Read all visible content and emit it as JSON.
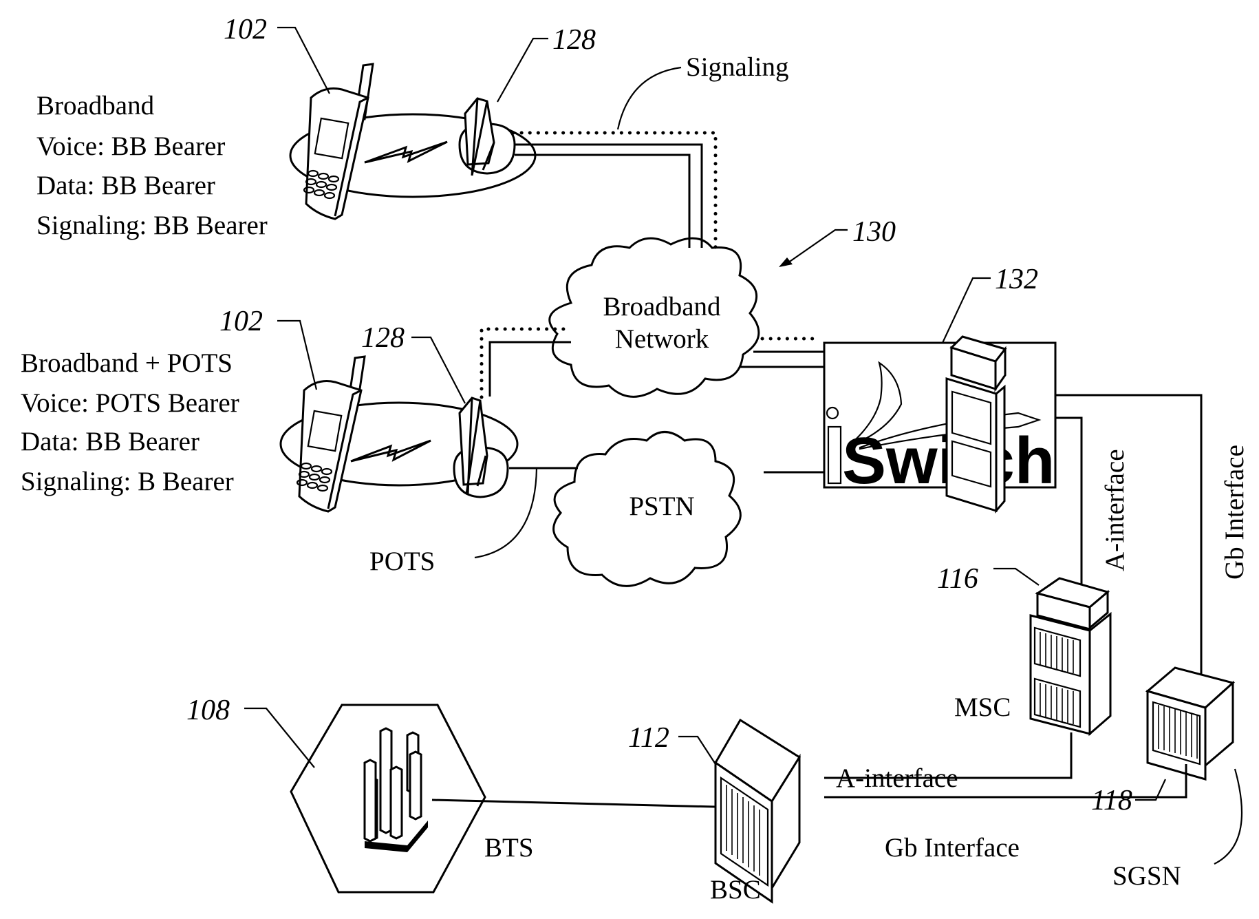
{
  "diagram": {
    "type": "network-architecture",
    "nodes": {
      "broadband_handset": {
        "ref": "102",
        "description_lines": [
          "Broadband",
          "Voice:  BB Bearer",
          "Data:   BB Bearer",
          "Signaling: BB Bearer"
        ],
        "icon": "mobile-phone-icon"
      },
      "broadband_base_station": {
        "ref": "128",
        "icon": "antenna-icon"
      },
      "pots_handset": {
        "ref": "102",
        "description_lines": [
          "Broadband + POTS",
          "Voice:  POTS Bearer",
          "Data:  BB Bearer",
          "Signaling: B Bearer"
        ],
        "icon": "mobile-phone-icon"
      },
      "pots_base_station": {
        "ref": "128",
        "icon": "antenna-icon"
      },
      "broadband_network": {
        "label_lines": [
          "Broadband",
          "Network"
        ],
        "ref": "130",
        "icon": "cloud-icon"
      },
      "pstn": {
        "label": "PSTN",
        "icon": "cloud-icon"
      },
      "iswitch": {
        "label_prefix": "i",
        "label_main": "Switch",
        "ref": "132",
        "icon": "server-icon"
      },
      "msc": {
        "label": "MSC",
        "ref": "116",
        "icon": "server-tower-icon"
      },
      "sgsn": {
        "label": "SGSN",
        "ref": "118",
        "icon": "server-cube-icon"
      },
      "bts": {
        "label": "BTS",
        "ref": "108",
        "icon": "cell-tower-icon"
      },
      "bsc": {
        "label": "BSC",
        "ref": "112",
        "icon": "server-cube-icon"
      }
    },
    "link_labels": {
      "signaling": "Signaling",
      "pots": "POTS",
      "a_interface_vertical": "A-interface",
      "gb_interface_vertical": "Gb Interface",
      "a_interface_bottom": "A-interface",
      "gb_interface_bottom": "Gb Interface"
    }
  }
}
